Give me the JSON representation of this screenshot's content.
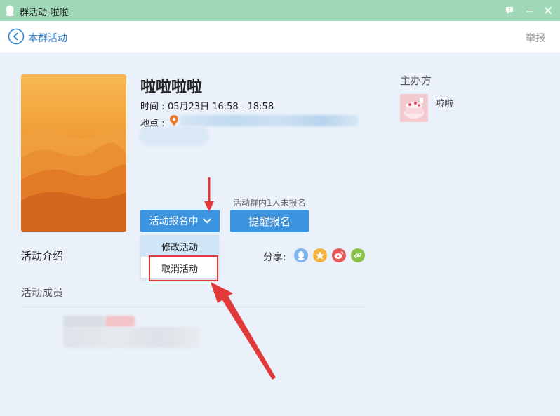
{
  "window": {
    "title": "群活动-啦啦",
    "titlebar_color": "#9fd7b7"
  },
  "nav": {
    "back_label": "本群活动",
    "report_label": "举报"
  },
  "event": {
    "title": "啦啦啦啦",
    "time_label": "时间 :",
    "time_value": "05月23日 16:58 - 18:58",
    "location_label": "地点 :"
  },
  "actions": {
    "signup_button": "活动报名中",
    "remind_hint": "活动群内1人未报名",
    "remind_button": "提醒报名",
    "accent_color": "#3d95df"
  },
  "dropdown": {
    "items": [
      "修改活动",
      "取消活动"
    ]
  },
  "sections": {
    "intro_label": "活动介绍",
    "members_label": "活动成员",
    "share_label": "分享:"
  },
  "share_icons": [
    "qq-icon",
    "qzone-star-icon",
    "weibo-icon",
    "link-icon"
  ],
  "host": {
    "label": "主办方",
    "name": "啦啦"
  },
  "annotation": {
    "color": "#e03a3a"
  }
}
